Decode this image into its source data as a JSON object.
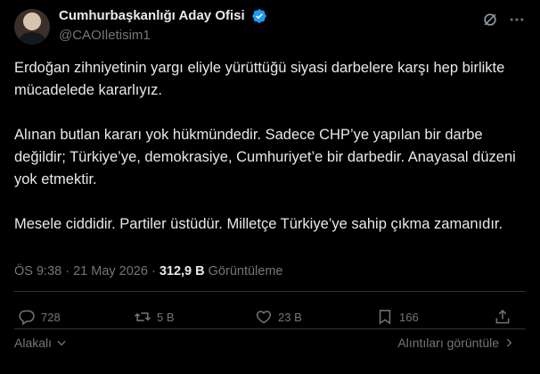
{
  "author": {
    "display_name": "Cumhurbaşkanlığı Aday Ofisi",
    "handle": "@CAOIletisim1"
  },
  "icons": {
    "verified": "verified-badge-icon",
    "grok": "grok-icon",
    "more": "more-icon"
  },
  "post": {
    "paragraphs": [
      "Erdoğan zihniyetinin yargı eliyle yürüttüğü siyasi darbelere karşı hep birlikte mücadelede kararlıyız.",
      "Alınan butlan kararı yok hükmündedir. Sadece CHP’ye yapılan bir darbe değildir; Türkiye’ye, demokrasiye, Cumhuriyet’e bir darbedir. Anayasal düzeni yok etmektir.",
      "Mesele ciddidir. Partiler üstüdür. Milletçe Türkiye’ye sahip çıkma zamanıdır."
    ],
    "time": "ÖS 9:38",
    "date": "21 May 2026",
    "views_count": "312,9 B",
    "views_label": "Görüntüleme"
  },
  "actions": {
    "replies": "728",
    "reposts": "5 B",
    "likes": "23 B",
    "bookmarks": "166"
  },
  "footer": {
    "related_label": "Alakalı",
    "quotes_label": "Alıntıları görüntüle"
  },
  "colors": {
    "background": "#000000",
    "text": "#e7e9ea",
    "muted": "#71767b",
    "verified": "#1d9bf0",
    "divider": "#2f3336"
  }
}
